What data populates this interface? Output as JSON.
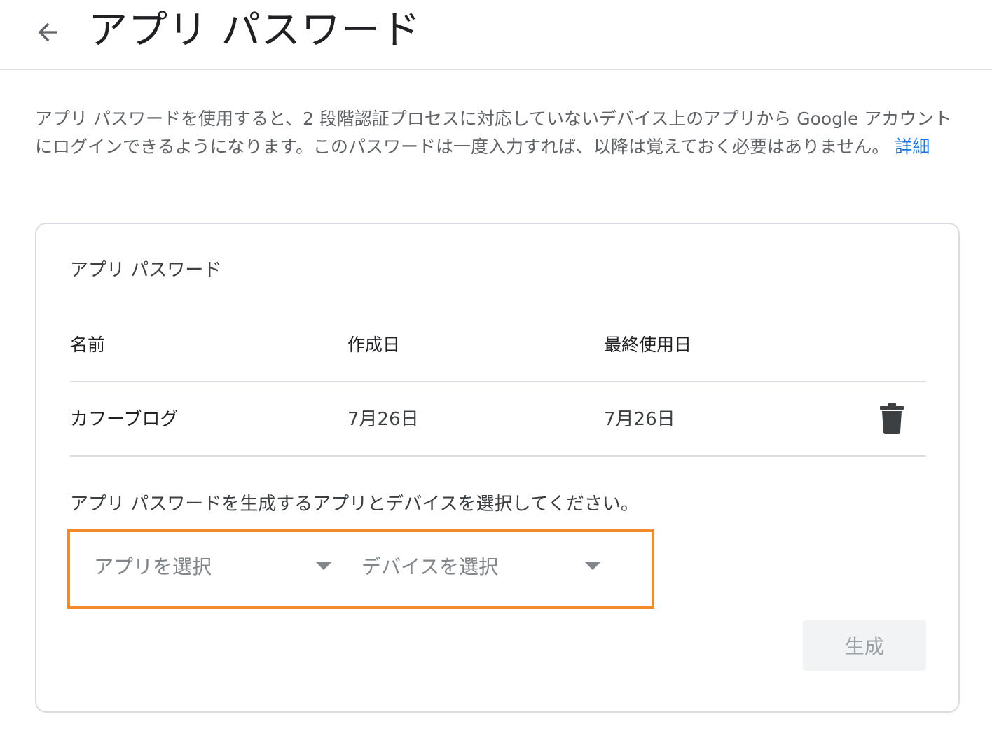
{
  "header": {
    "title": "アプリ パスワード"
  },
  "intro": {
    "text": "アプリ パスワードを使用すると、2 段階認証プロセスに対応していないデバイス上のアプリから Google アカウントにログインできるようになります。このパスワードは一度入力すれば、以降は覚えておく必要はありません。",
    "link": "詳細"
  },
  "card": {
    "title": "アプリ パスワード",
    "columns": [
      "名前",
      "作成日",
      "最終使用日"
    ],
    "rows": [
      {
        "name": "カフーブログ",
        "created": "7月26日",
        "last_used": "7月26日"
      }
    ],
    "prompt": "アプリ パスワードを生成するアプリとデバイスを選択してください。",
    "app_select": {
      "placeholder": "アプリを選択"
    },
    "device_select": {
      "placeholder": "デバイスを選択"
    },
    "generate_label": "生成"
  },
  "colors": {
    "highlight": "#f28a2a",
    "link": "#1a73e8"
  }
}
